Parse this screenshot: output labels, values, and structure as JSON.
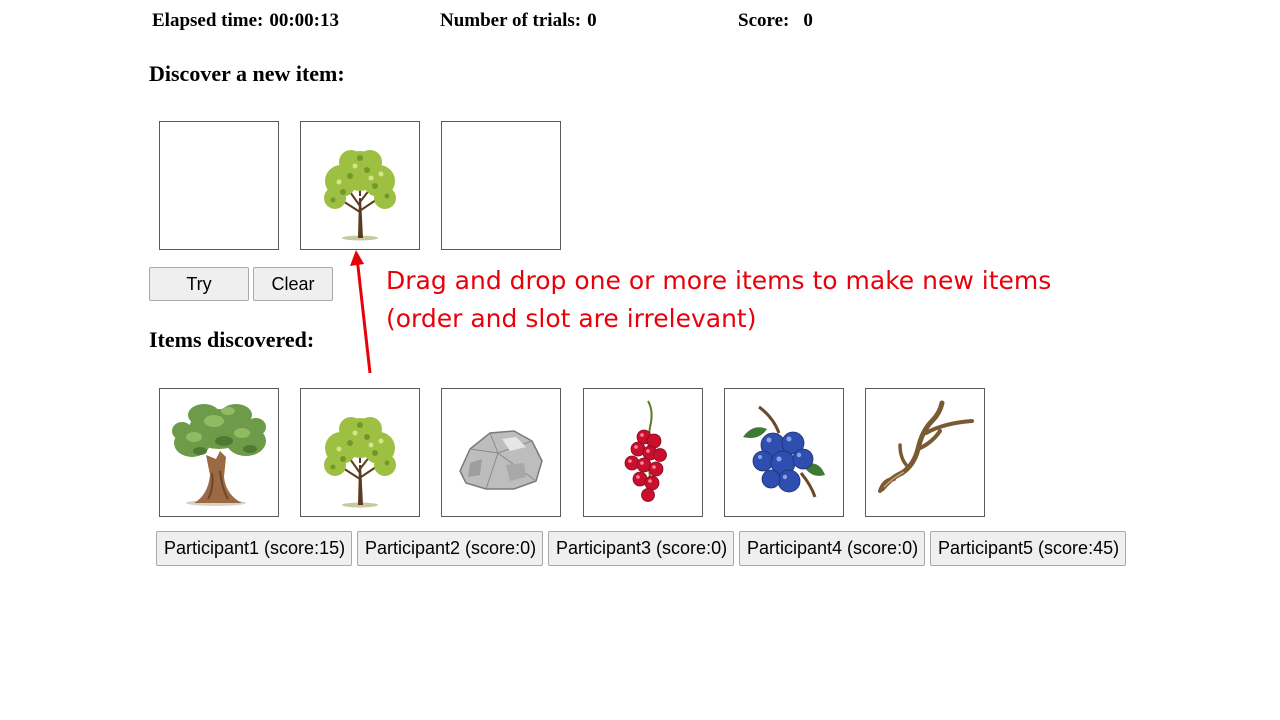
{
  "header": {
    "elapsed_label": "Elapsed time:",
    "elapsed_value": "00:00:13",
    "trials_label": "Number of trials:",
    "trials_value": "0",
    "score_label": "Score:",
    "score_value": "0"
  },
  "discover": {
    "title": "Discover a new item:",
    "slots": [
      {
        "item": ""
      },
      {
        "item": "young-tree"
      },
      {
        "item": ""
      }
    ],
    "try_label": "Try",
    "clear_label": "Clear"
  },
  "annotation": {
    "line1": "Drag and drop one or more items to make new items",
    "line2": "(order and slot are irrelevant)",
    "color": "#e8000b"
  },
  "discovered": {
    "title": "Items discovered:",
    "items": [
      {
        "icon": "oak-tree-icon"
      },
      {
        "icon": "young-tree-icon"
      },
      {
        "icon": "rock-icon"
      },
      {
        "icon": "red-currant-icon"
      },
      {
        "icon": "blueberry-icon"
      },
      {
        "icon": "antler-icon"
      }
    ]
  },
  "participants": [
    {
      "label": "Participant1 (score:15)"
    },
    {
      "label": "Participant2 (score:0)"
    },
    {
      "label": "Participant3 (score:0)"
    },
    {
      "label": "Participant4 (score:0)"
    },
    {
      "label": "Participant5 (score:45)"
    }
  ]
}
